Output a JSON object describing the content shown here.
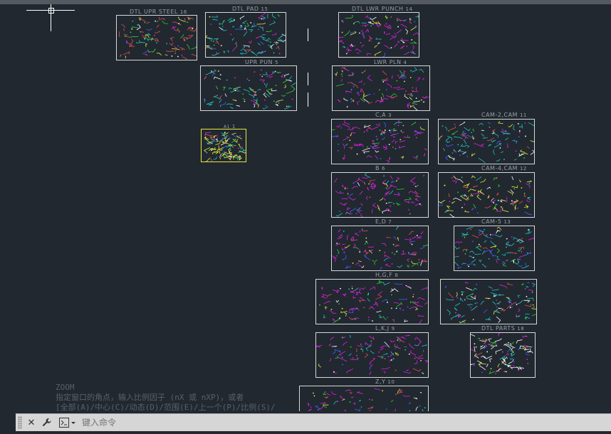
{
  "sheets": [
    {
      "id": "dtl-upr-steel",
      "title": "DTL UPR STEEL",
      "num": "16",
      "accent": "#e05050"
    },
    {
      "id": "dtl-pad",
      "title": "DTL PAD",
      "num": "15",
      "accent": "#22c0c0"
    },
    {
      "id": "dtl-lwr-punch",
      "title": "DTL LWR PUNCH",
      "num": "14",
      "accent": "#e020e0"
    },
    {
      "id": "upr-pun",
      "title": "UPR PUN",
      "num": "5",
      "accent": "#22c0c0"
    },
    {
      "id": "lwr-pln",
      "title": "LWR PLN",
      "num": "4",
      "accent": "#e020e0"
    },
    {
      "id": "a1",
      "title": "A1",
      "num": "1",
      "accent": "#e8e840"
    },
    {
      "id": "c-a",
      "title": "C,A",
      "num": "3",
      "accent": "#e020e0"
    },
    {
      "id": "cam-2",
      "title": "CAM-2,CAM",
      "num": "11",
      "accent": "#22c0c0"
    },
    {
      "id": "b",
      "title": "B",
      "num": "6",
      "accent": "#e020e0"
    },
    {
      "id": "cam-4",
      "title": "CAM-4,CAM",
      "num": "12",
      "accent": "#e8e840"
    },
    {
      "id": "e-d",
      "title": "E,D",
      "num": "7",
      "accent": "#e020e0"
    },
    {
      "id": "cam-5",
      "title": "CAM-5",
      "num": "13",
      "accent": "#22c0c0"
    },
    {
      "id": "h-g-f",
      "title": "H,G,F",
      "num": "8",
      "accent": "#e020e0"
    },
    {
      "id": "cam-extra",
      "title": "",
      "num": "",
      "accent": "#22c0c0"
    },
    {
      "id": "l-k-j",
      "title": "L,K,J",
      "num": "9",
      "accent": "#e020e0"
    },
    {
      "id": "dtl-parts",
      "title": "DTL PARTS",
      "num": "18",
      "accent": "#ffffff"
    },
    {
      "id": "z-y",
      "title": "Z,Y",
      "num": "10",
      "accent": "#e020e0"
    }
  ],
  "command_history": [
    "ZOOM",
    "指定窗口的角点，输入比例因子 (nX 或 nXP)，或者",
    "[全部(A)/中心(C)/动态(D)/范围(E)/上一个(P)/比例(S)/"
  ],
  "command_bar": {
    "placeholder": "键入命令",
    "close_icon": "close-icon",
    "settings_icon": "wrench-icon",
    "prompt_icon": "command-prompt-icon"
  }
}
